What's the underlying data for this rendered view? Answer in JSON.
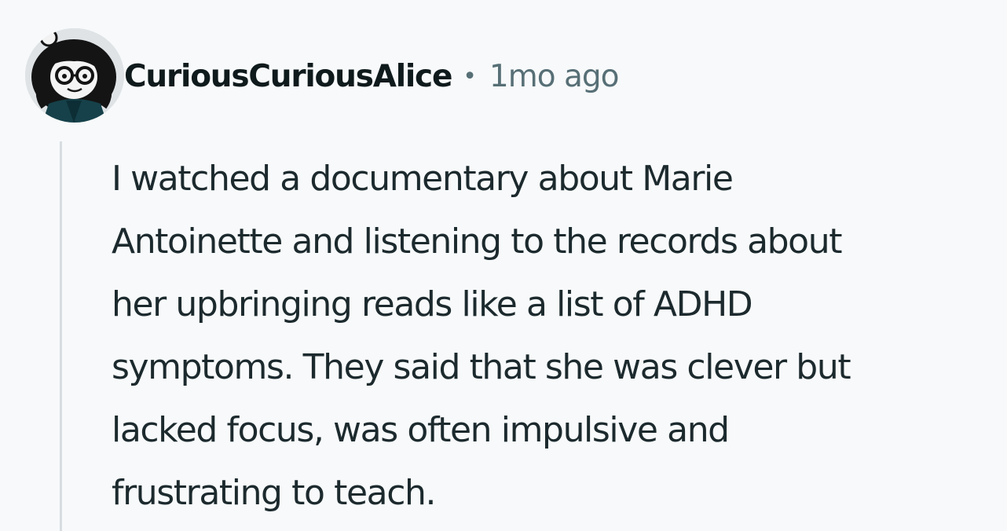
{
  "comment": {
    "author": "CuriousCuriousAlice",
    "separator": "•",
    "timestamp": "1mo ago",
    "body_lines": [
      "I watched a documentary about Marie",
      "Antoinette and listening to the records about",
      "her upbringing reads like a list of ADHD",
      "symptoms. They said that she was clever but",
      "lacked focus, was often impulsive and",
      "frustrating to teach."
    ]
  },
  "icons": {
    "avatar": "user-avatar-cartoon-girl-with-glasses"
  },
  "colors": {
    "background": "#f7f9fa",
    "username": "#0f1a1c",
    "meta_text": "#576f76",
    "body_text": "#1c2a2e",
    "thread_line": "#d7dde0"
  }
}
